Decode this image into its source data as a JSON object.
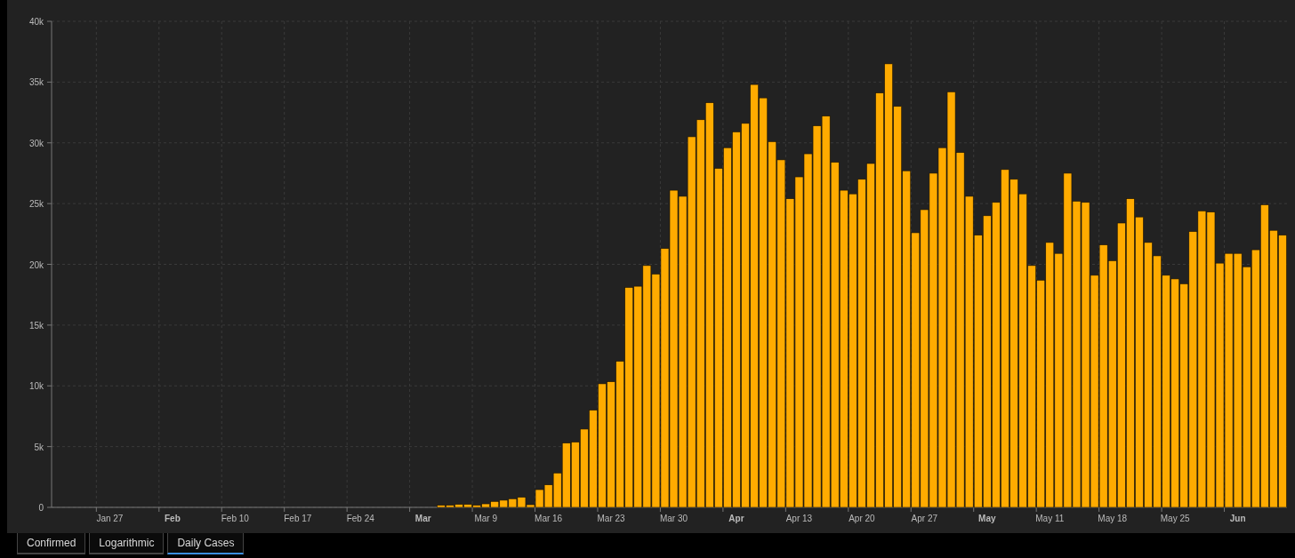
{
  "chart": {
    "chart_data": {
      "type": "bar",
      "categories": [
        null,
        null,
        null,
        null,
        null,
        null,
        "Jan 27",
        null,
        null,
        null,
        null,
        null,
        null,
        "Feb",
        null,
        null,
        null,
        null,
        null,
        null,
        "Feb 10",
        null,
        null,
        null,
        null,
        null,
        null,
        "Feb 17",
        null,
        null,
        null,
        null,
        null,
        null,
        "Feb 24",
        null,
        null,
        null,
        null,
        null,
        null,
        "Mar",
        null,
        null,
        null,
        null,
        null,
        null,
        "Mar 9",
        null,
        null,
        null,
        null,
        null,
        null,
        "Mar 16",
        null,
        null,
        null,
        null,
        null,
        null,
        "Mar 23",
        null,
        null,
        null,
        null,
        null,
        null,
        "Mar 30",
        null,
        null,
        null,
        null,
        null,
        null,
        "Apr",
        null,
        null,
        null,
        null,
        null,
        null,
        "Apr 13",
        null,
        null,
        null,
        null,
        null,
        null,
        "Apr 20",
        null,
        null,
        null,
        null,
        null,
        null,
        "Apr 27",
        null,
        null,
        null,
        null,
        null,
        null,
        "May",
        null,
        null,
        null,
        null,
        null,
        null,
        "May 11",
        null,
        null,
        null,
        null,
        null,
        null,
        "May 18",
        null,
        null,
        null,
        null,
        null,
        null,
        "May 25",
        null,
        null,
        null,
        null,
        null,
        null,
        "Jun",
        null,
        null,
        null,
        null,
        null
      ],
      "series": [
        {
          "color": "#ffab00",
          "values": [
            0,
            0,
            0,
            0,
            0,
            0,
            0,
            0,
            0,
            0,
            0,
            0,
            0,
            0,
            0,
            0,
            0,
            0,
            0,
            0,
            0,
            0,
            0,
            0,
            0,
            0,
            0,
            0,
            0,
            0,
            0,
            0,
            0,
            0,
            0,
            0,
            0,
            0,
            0,
            0,
            0,
            0,
            0,
            170,
            170,
            240,
            240,
            170,
            290,
            490,
            590,
            710,
            830,
            220,
            1460,
            1850,
            2830,
            5290,
            5370,
            6440,
            8000,
            10170,
            10340,
            12020,
            18100,
            18200,
            19900,
            19200,
            21300,
            26100,
            25600,
            30500,
            31900,
            33300,
            27900,
            29600,
            30900,
            31600,
            34800,
            33700,
            30100,
            28600,
            25400,
            27200,
            29100,
            31400,
            32200,
            28400,
            26100,
            25800,
            27000,
            28300,
            34100,
            36500,
            33000,
            27700,
            22600,
            24500,
            27500,
            29600,
            34200,
            29200,
            25600,
            22400,
            24000,
            25100,
            27800,
            27000,
            25800,
            19900,
            18700,
            21800,
            20900,
            27500,
            25200,
            25100,
            19100,
            21600,
            20300,
            23400,
            25400,
            23900,
            21800,
            20700,
            19100,
            18800,
            18400,
            22700,
            24400,
            24300,
            20100,
            20900,
            20900,
            19800,
            21200,
            24900,
            22800,
            22400
          ]
        }
      ],
      "ylim": [
        0,
        40000
      ],
      "yticks": [
        {
          "value": 0,
          "label": "0"
        },
        {
          "value": 5000,
          "label": "5k"
        },
        {
          "value": 10000,
          "label": "10k"
        },
        {
          "value": 15000,
          "label": "15k"
        },
        {
          "value": 20000,
          "label": "20k"
        },
        {
          "value": 25000,
          "label": "25k"
        },
        {
          "value": 30000,
          "label": "30k"
        },
        {
          "value": 35000,
          "label": "35k"
        },
        {
          "value": 40000,
          "label": "40k"
        }
      ],
      "grid": true
    }
  },
  "tabs": [
    {
      "label": "Confirmed",
      "selected": false
    },
    {
      "label": "Logarithmic",
      "selected": false
    },
    {
      "label": "Daily Cases",
      "selected": true
    }
  ]
}
